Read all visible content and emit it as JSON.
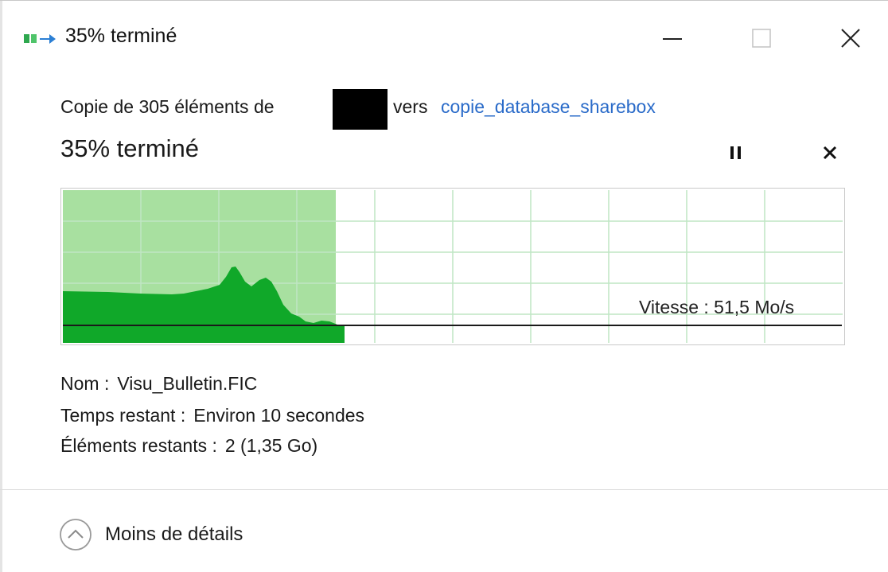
{
  "window": {
    "title": "35% terminé"
  },
  "copy": {
    "prefix": "Copie de 305 éléments de",
    "vers": "vers",
    "destination": "copie_database_sharebox"
  },
  "progress": {
    "title": "35% terminé",
    "fraction": 0.35
  },
  "graph": {
    "speed_label": "Vitesse : 51,5 Mo/s",
    "colors": {
      "fill_done": "#a8e0a0",
      "speed_area": "#10a829",
      "grid": "#bfe6c4",
      "line": "#1a1a1a"
    }
  },
  "details": {
    "name_label": "Nom :",
    "name_value": "Visu_Bulletin.FIC",
    "time_label": "Temps restant :",
    "time_value": "Environ 10 secondes",
    "items_label": "Éléments restants :",
    "items_value": "2 (1,35 Go)"
  },
  "footer": {
    "less_details": "Moins de détails"
  },
  "icons": {
    "title": "copy-progress-icon",
    "minimize": "minimize-icon",
    "maximize": "maximize-icon",
    "close": "close-icon",
    "pause": "pause-icon",
    "cancel": "cancel-icon",
    "chevron": "chevron-up-icon"
  }
}
